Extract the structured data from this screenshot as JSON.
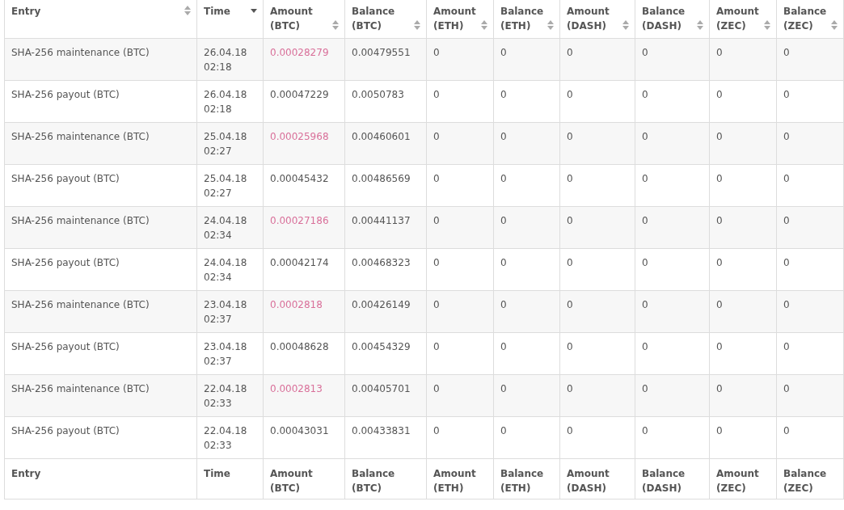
{
  "table": {
    "columns": [
      {
        "label": "Entry",
        "sorted": false
      },
      {
        "label": "Time",
        "sorted": true
      },
      {
        "label": "Amount\n(BTC)",
        "sorted": false
      },
      {
        "label": "Balance\n(BTC)",
        "sorted": false
      },
      {
        "label": "Amount\n(ETH)",
        "sorted": false
      },
      {
        "label": "Balance\n(ETH)",
        "sorted": false
      },
      {
        "label": "Amount\n(DASH)",
        "sorted": false
      },
      {
        "label": "Balance\n(DASH)",
        "sorted": false
      },
      {
        "label": "Amount\n(ZEC)",
        "sorted": false
      },
      {
        "label": "Balance\n(ZEC)",
        "sorted": false
      }
    ],
    "rows": [
      {
        "debit": true,
        "cells": [
          "SHA-256 maintenance (BTC)",
          "26.04.18\n02:18",
          "0.00028279",
          "0.00479551",
          "0",
          "0",
          "0",
          "0",
          "0",
          "0"
        ]
      },
      {
        "debit": false,
        "cells": [
          "SHA-256 payout (BTC)",
          "26.04.18\n02:18",
          "0.00047229",
          "0.0050783",
          "0",
          "0",
          "0",
          "0",
          "0",
          "0"
        ]
      },
      {
        "debit": true,
        "cells": [
          "SHA-256 maintenance (BTC)",
          "25.04.18\n02:27",
          "0.00025968",
          "0.00460601",
          "0",
          "0",
          "0",
          "0",
          "0",
          "0"
        ]
      },
      {
        "debit": false,
        "cells": [
          "SHA-256 payout (BTC)",
          "25.04.18\n02:27",
          "0.00045432",
          "0.00486569",
          "0",
          "0",
          "0",
          "0",
          "0",
          "0"
        ]
      },
      {
        "debit": true,
        "cells": [
          "SHA-256 maintenance (BTC)",
          "24.04.18\n02:34",
          "0.00027186",
          "0.00441137",
          "0",
          "0",
          "0",
          "0",
          "0",
          "0"
        ]
      },
      {
        "debit": false,
        "cells": [
          "SHA-256 payout (BTC)",
          "24.04.18\n02:34",
          "0.00042174",
          "0.00468323",
          "0",
          "0",
          "0",
          "0",
          "0",
          "0"
        ]
      },
      {
        "debit": true,
        "cells": [
          "SHA-256 maintenance (BTC)",
          "23.04.18\n02:37",
          "0.0002818",
          "0.00426149",
          "0",
          "0",
          "0",
          "0",
          "0",
          "0"
        ]
      },
      {
        "debit": false,
        "cells": [
          "SHA-256 payout (BTC)",
          "23.04.18\n02:37",
          "0.00048628",
          "0.00454329",
          "0",
          "0",
          "0",
          "0",
          "0",
          "0"
        ]
      },
      {
        "debit": true,
        "cells": [
          "SHA-256 maintenance (BTC)",
          "22.04.18\n02:33",
          "0.0002813",
          "0.00405701",
          "0",
          "0",
          "0",
          "0",
          "0",
          "0"
        ]
      },
      {
        "debit": false,
        "cells": [
          "SHA-256 payout (BTC)",
          "22.04.18\n02:33",
          "0.00043031",
          "0.00433831",
          "0",
          "0",
          "0",
          "0",
          "0",
          "0"
        ]
      }
    ],
    "footer": [
      "Entry",
      "Time",
      "Amount\n(BTC)",
      "Balance\n(BTC)",
      "Amount\n(ETH)",
      "Balance\n(ETH)",
      "Amount\n(DASH)",
      "Balance\n(DASH)",
      "Amount\n(ZEC)",
      "Balance\n(ZEC)"
    ]
  }
}
